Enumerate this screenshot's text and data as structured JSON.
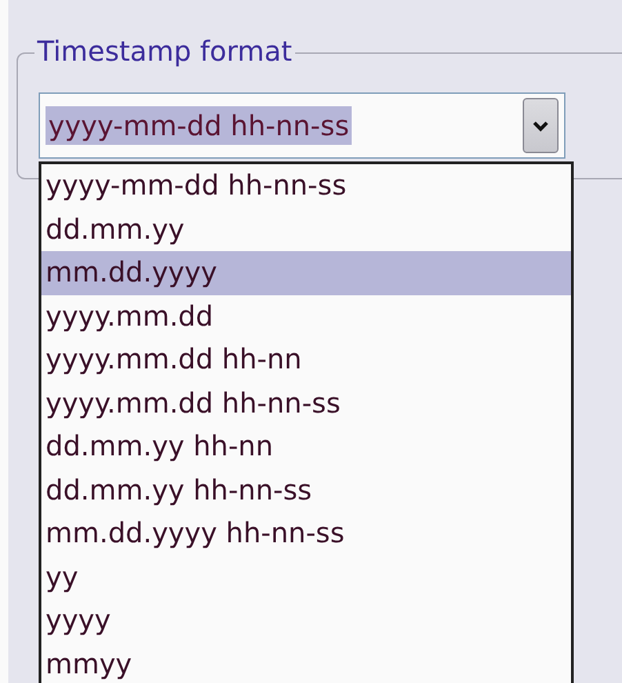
{
  "group": {
    "title": "Timestamp format"
  },
  "combo": {
    "value": "yyyy-mm-dd hh-nn-ss",
    "value_highlighted": true,
    "expanded": true
  },
  "options": [
    {
      "label": "yyyy-mm-dd hh-nn-ss",
      "selected": false
    },
    {
      "label": "dd.mm.yy",
      "selected": false
    },
    {
      "label": "mm.dd.yyyy",
      "selected": true
    },
    {
      "label": "yyyy.mm.dd",
      "selected": false
    },
    {
      "label": "yyyy.mm.dd hh-nn",
      "selected": false
    },
    {
      "label": "yyyy.mm.dd hh-nn-ss",
      "selected": false
    },
    {
      "label": "dd.mm.yy hh-nn",
      "selected": false
    },
    {
      "label": "dd.mm.yy hh-nn-ss",
      "selected": false
    },
    {
      "label": "mm.dd.yyyy hh-nn-ss",
      "selected": false
    },
    {
      "label": "yy",
      "selected": false
    },
    {
      "label": "yyyy",
      "selected": false
    },
    {
      "label": "mmyy",
      "selected": false
    }
  ]
}
